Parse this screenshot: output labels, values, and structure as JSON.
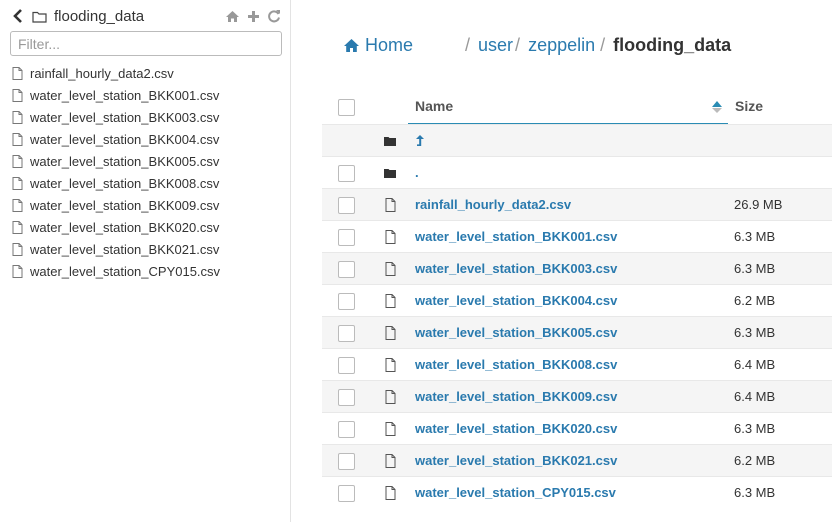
{
  "sidebar": {
    "title": "flooding_data",
    "filter_placeholder": "Filter...",
    "icons": [
      "chevron-left-icon",
      "folder-icon",
      "home-icon",
      "plus-icon",
      "refresh-icon"
    ],
    "files": [
      "rainfall_hourly_data2.csv",
      "water_level_station_BKK001.csv",
      "water_level_station_BKK003.csv",
      "water_level_station_BKK004.csv",
      "water_level_station_BKK005.csv",
      "water_level_station_BKK008.csv",
      "water_level_station_BKK009.csv",
      "water_level_station_BKK020.csv",
      "water_level_station_BKK021.csv",
      "water_level_station_CPY015.csv"
    ]
  },
  "breadcrumb": {
    "home": "Home",
    "separator": "/",
    "path": [
      "user",
      "zeppelin"
    ],
    "current": "flooding_data"
  },
  "table": {
    "headers": {
      "name": "Name",
      "size": "Size"
    },
    "rows": [
      {
        "type": "parent",
        "name": "",
        "size": ""
      },
      {
        "type": "folder",
        "name": ".",
        "size": ""
      },
      {
        "type": "file",
        "name": "rainfall_hourly_data2.csv",
        "size": "26.9 MB"
      },
      {
        "type": "file",
        "name": "water_level_station_BKK001.csv",
        "size": "6.3 MB"
      },
      {
        "type": "file",
        "name": "water_level_station_BKK003.csv",
        "size": "6.3 MB"
      },
      {
        "type": "file",
        "name": "water_level_station_BKK004.csv",
        "size": "6.2 MB"
      },
      {
        "type": "file",
        "name": "water_level_station_BKK005.csv",
        "size": "6.3 MB"
      },
      {
        "type": "file",
        "name": "water_level_station_BKK008.csv",
        "size": "6.4 MB"
      },
      {
        "type": "file",
        "name": "water_level_station_BKK009.csv",
        "size": "6.4 MB"
      },
      {
        "type": "file",
        "name": "water_level_station_BKK020.csv",
        "size": "6.3 MB"
      },
      {
        "type": "file",
        "name": "water_level_station_BKK021.csv",
        "size": "6.2 MB"
      },
      {
        "type": "file",
        "name": "water_level_station_CPY015.csv",
        "size": "6.3 MB"
      }
    ]
  },
  "colors": {
    "link": "#2a7aae",
    "header_underline": "#2a8cb4",
    "alt_row": "#f5f5f5"
  }
}
